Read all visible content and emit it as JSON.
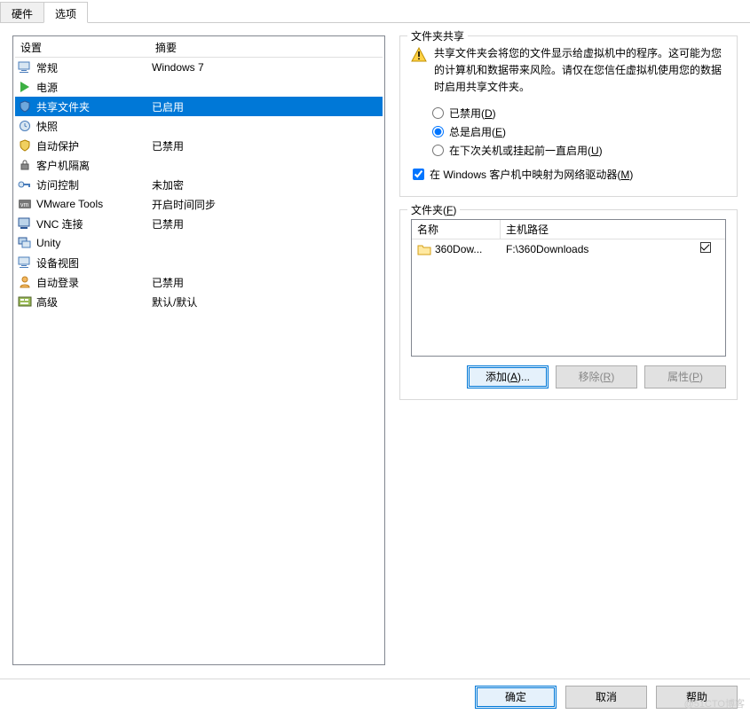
{
  "tabs": {
    "hardware": "硬件",
    "options": "选项"
  },
  "list": {
    "header_setting": "设置",
    "header_summary": "摘要",
    "items": [
      {
        "name": "general",
        "label": "常规",
        "summary": "Windows 7"
      },
      {
        "name": "power",
        "label": "电源",
        "summary": ""
      },
      {
        "name": "shared-folders",
        "label": "共享文件夹",
        "summary": "已启用"
      },
      {
        "name": "snapshots",
        "label": "快照",
        "summary": ""
      },
      {
        "name": "autoprotect",
        "label": "自动保护",
        "summary": "已禁用"
      },
      {
        "name": "guest-iso",
        "label": "客户机隔离",
        "summary": ""
      },
      {
        "name": "access-ctrl",
        "label": "访问控制",
        "summary": "未加密"
      },
      {
        "name": "vmware-tools",
        "label": "VMware Tools",
        "summary": "开启时间同步"
      },
      {
        "name": "vnc",
        "label": "VNC 连接",
        "summary": "已禁用"
      },
      {
        "name": "unity",
        "label": "Unity",
        "summary": ""
      },
      {
        "name": "device-view",
        "label": "设备视图",
        "summary": ""
      },
      {
        "name": "autologin",
        "label": "自动登录",
        "summary": "已禁用"
      },
      {
        "name": "advanced",
        "label": "高级",
        "summary": "默认/默认"
      }
    ]
  },
  "share": {
    "group_title": "文件夹共享",
    "warn_text": "共享文件夹会将您的文件显示给虚拟机中的程序。这可能为您的计算机和数据带来风险。请仅在您信任虚拟机使用您的数据时启用共享文件夹。",
    "radio_disabled_pre": "已禁用(",
    "radio_disabled_key": "D",
    "radio_enabled_pre": "总是启用(",
    "radio_enabled_key": "E",
    "radio_until_pre": "在下次关机或挂起前一直启用(",
    "radio_until_key": "U",
    "radio_post": ")",
    "check_map_pre": "在 Windows 客户机中映射为网络驱动器(",
    "check_map_key": "M",
    "check_map_post": ")"
  },
  "folders": {
    "group_title_pre": "文件夹(",
    "group_title_key": "F",
    "group_title_post": ")",
    "col_name": "名称",
    "col_path": "主机路径",
    "rows": [
      {
        "name": "360Dow...",
        "path": "F:\\360Downloads"
      }
    ],
    "btn_add_pre": "添加(",
    "btn_add_key": "A",
    "btn_add_post": ")...",
    "btn_remove_pre": "移除(",
    "btn_remove_key": "R",
    "btn_remove_post": ")",
    "btn_props_pre": "属性(",
    "btn_props_key": "P",
    "btn_props_post": ")"
  },
  "footer": {
    "ok": "确定",
    "cancel": "取消",
    "help": "帮助"
  },
  "watermark": "@51CTO博客"
}
